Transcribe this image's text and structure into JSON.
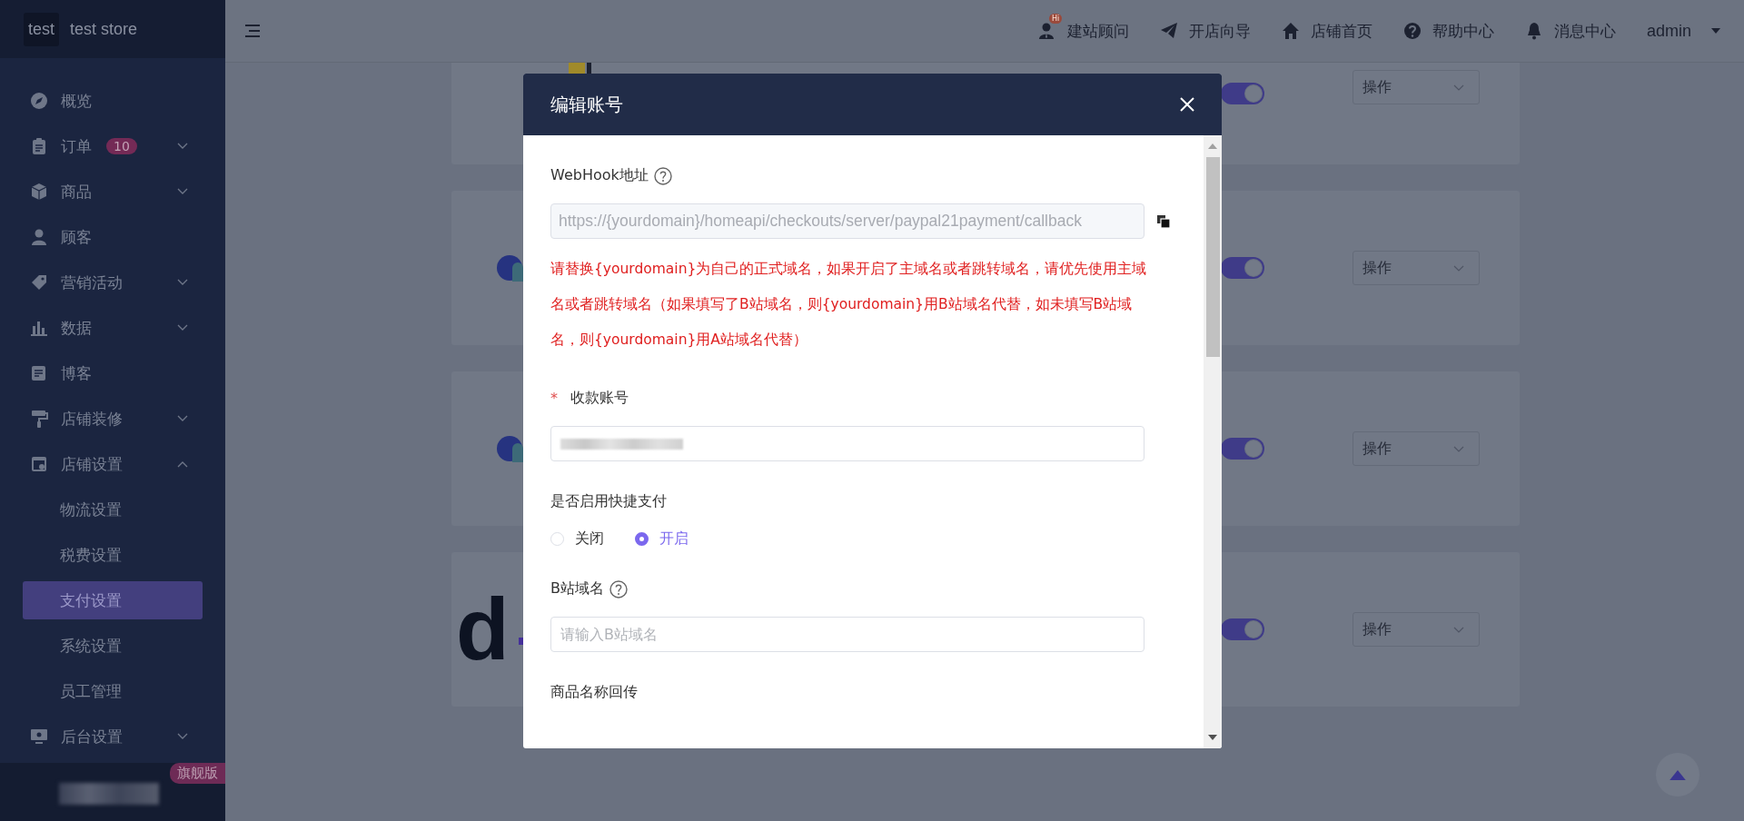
{
  "sidebar": {
    "logo": "test",
    "store_name": "test store",
    "plan_badge": "旗舰版",
    "items": [
      {
        "kind": "link",
        "label": "概览",
        "selected": false
      },
      {
        "kind": "group",
        "label": "订单",
        "badge": "10",
        "expanded": false,
        "selected": false
      },
      {
        "kind": "group",
        "label": "商品",
        "expanded": false,
        "selected": false
      },
      {
        "kind": "link",
        "label": "顾客",
        "selected": false
      },
      {
        "kind": "group",
        "label": "营销活动",
        "expanded": false,
        "selected": false
      },
      {
        "kind": "group",
        "label": "数据",
        "expanded": false,
        "selected": false
      },
      {
        "kind": "link",
        "label": "博客",
        "selected": false
      },
      {
        "kind": "group",
        "label": "店铺装修",
        "expanded": false,
        "selected": false
      },
      {
        "kind": "group",
        "label": "店铺设置",
        "expanded": true,
        "selected": false,
        "children": [
          {
            "label": "物流设置",
            "selected": false
          },
          {
            "label": "税费设置",
            "selected": false
          },
          {
            "label": "支付设置",
            "selected": true
          },
          {
            "label": "系统设置",
            "selected": false
          },
          {
            "label": "员工管理",
            "selected": false
          }
        ]
      },
      {
        "kind": "group",
        "label": "后台设置",
        "expanded": false,
        "selected": false
      }
    ]
  },
  "top_bar": {
    "nav": [
      {
        "label": "建站顾问",
        "badge": "Hi"
      },
      {
        "label": "开店向导"
      },
      {
        "label": "店铺首页"
      },
      {
        "label": "帮助中心"
      },
      {
        "label": "消息中心"
      }
    ],
    "user": "admin"
  },
  "payment_cards": [
    {
      "kind": "tile",
      "on": true,
      "action": "操作"
    },
    {
      "kind": "circle",
      "on": true,
      "action": "操作"
    },
    {
      "kind": "circle",
      "on": true,
      "action": "操作"
    },
    {
      "kind": "letter",
      "logo_text": "d",
      "on": true,
      "action": "操作"
    }
  ],
  "dialog": {
    "title": "编辑账号",
    "fields": [
      {
        "kind": "readonly",
        "label": "WebHook地址",
        "help": true,
        "value": "https://{yourdomain}/homeapi/checkouts/server/paypal21payment/callback",
        "note": "请替换{yourdomain}为自己的正式域名，如果开启了主域名或者跳转域名，请优先使用主域名或者跳转域名（如果填写了B站域名，则{yourdomain}用B站域名代替，如未填写B站域名，则{yourdomain}用A站域名代替）"
      },
      {
        "kind": "redacted",
        "label": "收款账号",
        "required_mark": "*"
      },
      {
        "kind": "radio",
        "label": "是否启用快捷支付",
        "options": [
          {
            "label": "关闭",
            "selected": false
          },
          {
            "label": "开启",
            "selected": true
          }
        ]
      },
      {
        "kind": "text",
        "label": "B站域名",
        "help": true,
        "placeholder": "请输入B站域名"
      },
      {
        "kind": "heading",
        "label": "商品名称回传"
      }
    ]
  }
}
